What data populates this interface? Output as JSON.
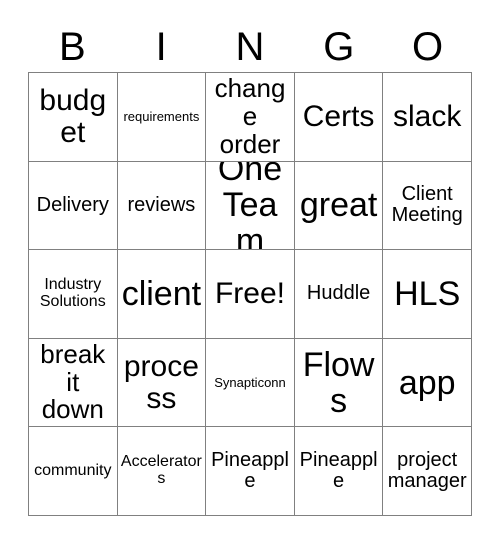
{
  "card": {
    "title": "BINGO",
    "header_letters": [
      "B",
      "I",
      "N",
      "G",
      "O"
    ],
    "free_space_label": "Free!",
    "colors": {
      "background": "#ffffff",
      "text": "#000000",
      "grid_line": "#808080"
    },
    "rows": [
      [
        {
          "label": "budget",
          "size": "xl"
        },
        {
          "label": "requirements",
          "size": "xs"
        },
        {
          "label": "change\norder",
          "size": "lg"
        },
        {
          "label": "Certs",
          "size": "xl"
        },
        {
          "label": "slack",
          "size": "xl"
        }
      ],
      [
        {
          "label": "Delivery",
          "size": "md"
        },
        {
          "label": "reviews",
          "size": "md"
        },
        {
          "label": "One\nTeam",
          "size": "xxl"
        },
        {
          "label": "great",
          "size": "xxl"
        },
        {
          "label": "Client\nMeeting",
          "size": "md"
        }
      ],
      [
        {
          "label": "Industry\nSolutions",
          "size": "sm"
        },
        {
          "label": "client",
          "size": "xxl"
        },
        {
          "label": "Free!",
          "size": "xl"
        },
        {
          "label": "Huddle",
          "size": "md"
        },
        {
          "label": "HLS",
          "size": "xxl"
        }
      ],
      [
        {
          "label": "break\nit down",
          "size": "lg"
        },
        {
          "label": "process",
          "size": "xl"
        },
        {
          "label": "Synapticonn",
          "size": "xs"
        },
        {
          "label": "Flows",
          "size": "xxl"
        },
        {
          "label": "app",
          "size": "xxl"
        }
      ],
      [
        {
          "label": "community",
          "size": "sm"
        },
        {
          "label": "Accelerators",
          "size": "sm"
        },
        {
          "label": "Pineapple",
          "size": "md"
        },
        {
          "label": "Pineapple",
          "size": "md"
        },
        {
          "label": "project\nmanager",
          "size": "md"
        }
      ]
    ]
  }
}
